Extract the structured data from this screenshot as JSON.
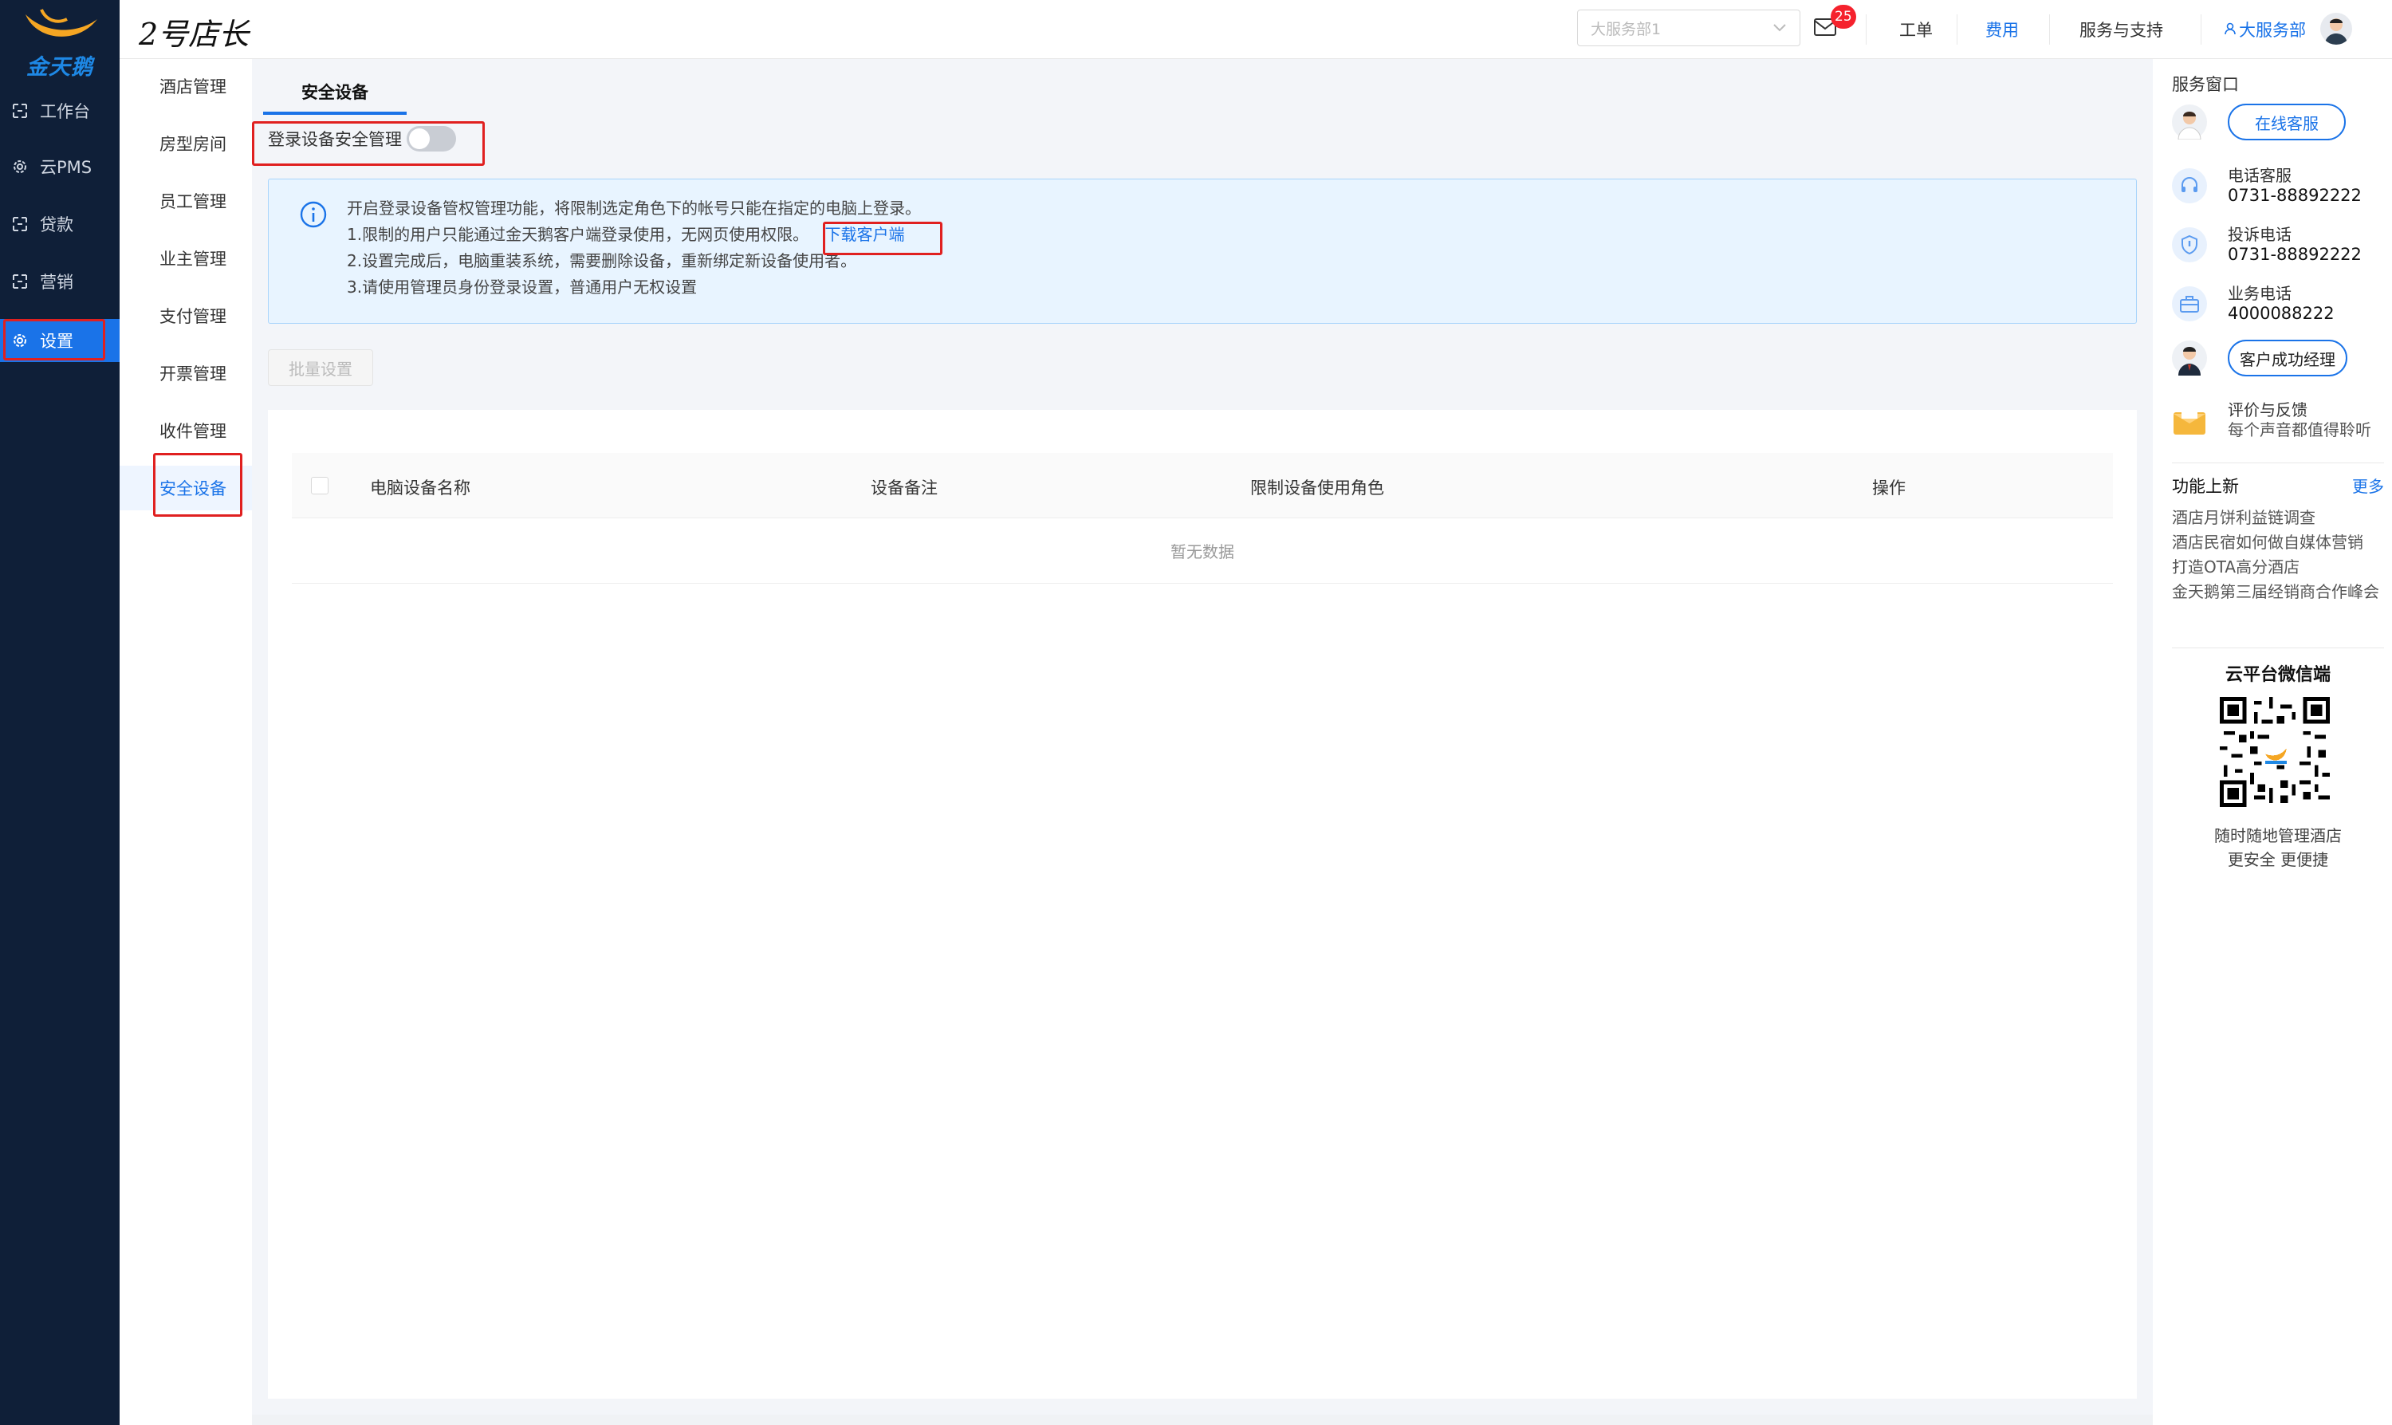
{
  "brand": {
    "name": "金天鹅"
  },
  "sidebar": {
    "items": [
      {
        "label": "工作台",
        "icon": "dashboard-icon"
      },
      {
        "label": "云PMS",
        "icon": "gear-icon"
      },
      {
        "label": "贷款",
        "icon": "loan-icon"
      },
      {
        "label": "营销",
        "icon": "marketing-icon"
      },
      {
        "label": "设置",
        "icon": "settings-icon",
        "active": true
      }
    ]
  },
  "header": {
    "shop_title": "2号店长",
    "dept_select": {
      "value": "大服务部1"
    },
    "mail_badge": "25",
    "links": {
      "work_order": "工单",
      "fees": "费用",
      "service": "服务与支持",
      "user": "大服务部"
    }
  },
  "submenu": {
    "items": [
      "酒店管理",
      "房型房间",
      "员工管理",
      "业主管理",
      "支付管理",
      "开票管理",
      "收件管理",
      "安全设备"
    ],
    "active_index": 7
  },
  "main": {
    "tab": "安全设备",
    "toggle_label": "登录设备安全管理",
    "toggle_on": false,
    "info": {
      "line0": "开启登录设备管权管理功能，将限制选定角色下的帐号只能在指定的电脑上登录。",
      "line1": "1.限制的用户只能通过金天鹅客户端登录使用，无网页使用权限。",
      "line1_link": "下载客户端",
      "line2": "2.设置完成后，电脑重装系统，需要删除设备，重新绑定新设备使用者。",
      "line3": "3.请使用管理员身份登录设置，普通用户无权设置"
    },
    "batch_button": "批量设置",
    "table": {
      "columns": [
        "电脑设备名称",
        "设备备注",
        "限制设备使用角色",
        "操作"
      ],
      "empty_text": "暂无数据"
    }
  },
  "right_panel": {
    "title": "服务窗口",
    "online_service": "在线客服",
    "phone_service": {
      "label": "电话客服",
      "number": "0731-88892222"
    },
    "complaint": {
      "label": "投诉电话",
      "number": "0731-88892222"
    },
    "business": {
      "label": "业务电话",
      "number": "4000088222"
    },
    "success_manager": "客户成功经理",
    "feedback": {
      "label": "评价与反馈",
      "sub": "每个声音都值得聆听"
    },
    "news": {
      "title": "功能上新",
      "more": "更多",
      "items": [
        "酒店月饼利益链调查",
        "酒店民宿如何做自媒体营销",
        "打造OTA高分酒店",
        "金天鹅第三届经销商合作峰会"
      ]
    },
    "qr": {
      "title": "云平台微信端",
      "caption1": "随时随地管理酒店",
      "caption2": "更安全 更便捷"
    }
  },
  "colors": {
    "accent": "#1a73e8",
    "sidebar_bg": "#0f1f38",
    "highlight": "#e02020"
  }
}
